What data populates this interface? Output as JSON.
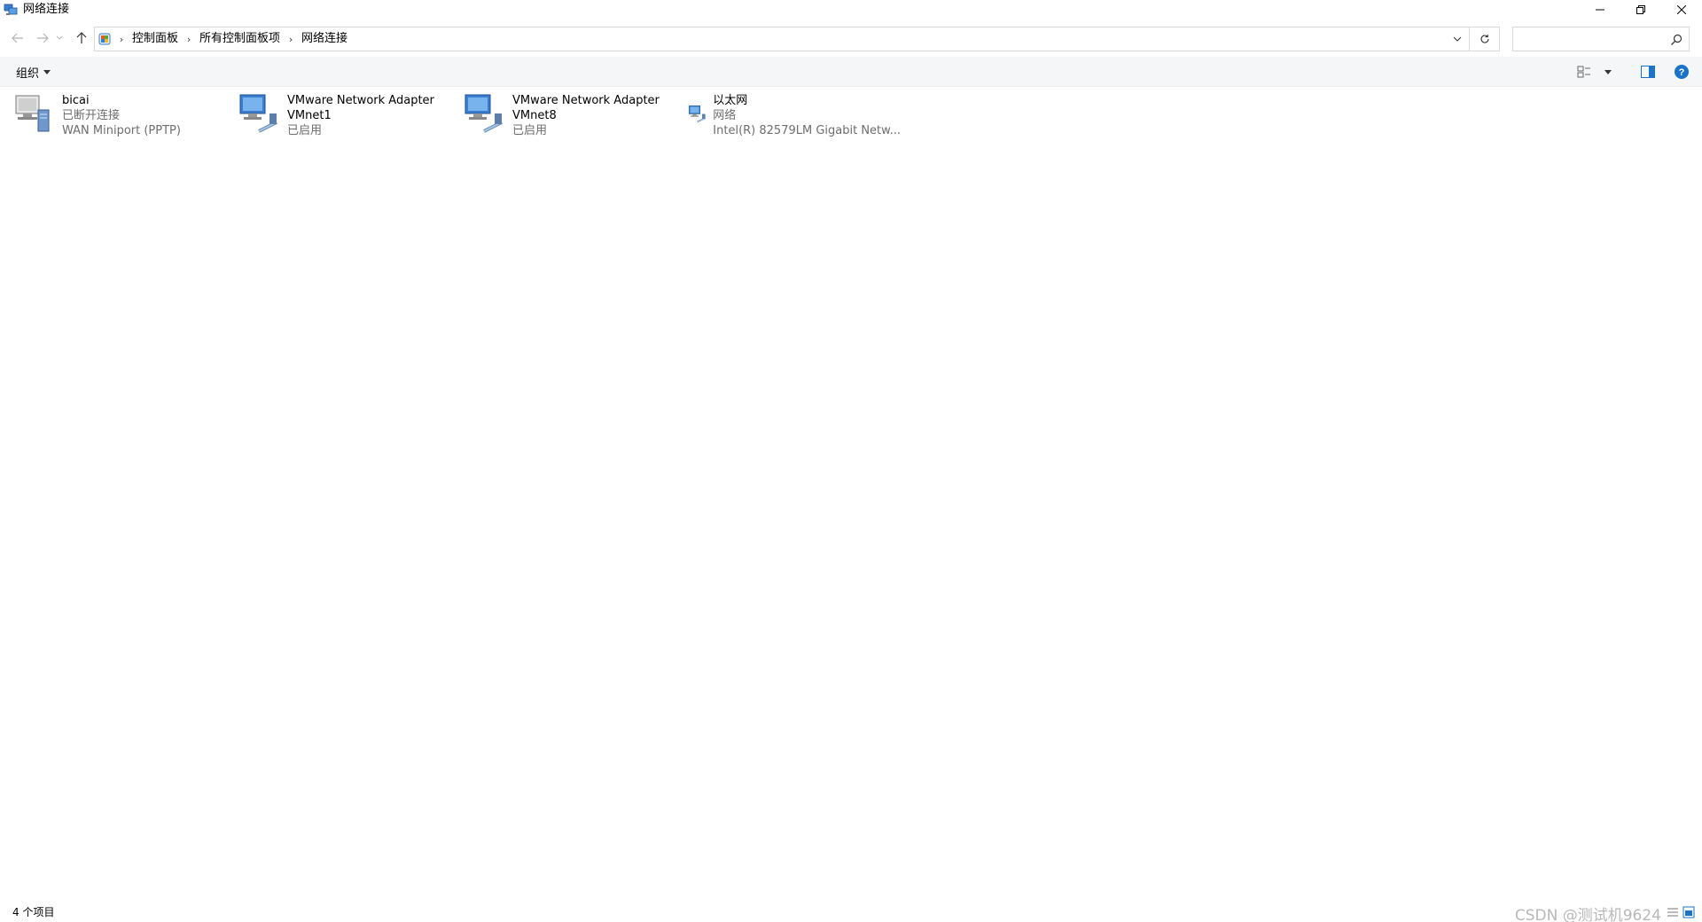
{
  "window": {
    "title": "网络连接",
    "colors": {
      "accent": "#1a73c8",
      "subtext": "#6d6d6d",
      "border": "#d9d9d9",
      "commandbar_bg": "#f5f6f7"
    }
  },
  "breadcrumb": {
    "items": [
      "控制面板",
      "所有控制面板项",
      "网络连接"
    ]
  },
  "search": {
    "placeholder": "",
    "value": ""
  },
  "commandbar": {
    "organize_label": "组织"
  },
  "items": [
    {
      "name": "bicai",
      "line2": "已断开连接",
      "line3": "WAN Miniport (PPTP)",
      "icon": "vpn-connection-icon"
    },
    {
      "name": "VMware Network Adapter",
      "line2": "VMnet1",
      "line3": "已启用",
      "icon": "network-adapter-icon"
    },
    {
      "name": "VMware Network Adapter",
      "line2": "VMnet8",
      "line3": "已启用",
      "icon": "network-adapter-icon"
    },
    {
      "name": "以太网",
      "line2": "网络",
      "line3": "Intel(R) 82579LM Gigabit Netw...",
      "icon": "network-adapter-icon"
    }
  ],
  "status": {
    "count_label": "4 个项目",
    "watermark": "CSDN @测试机9624"
  }
}
